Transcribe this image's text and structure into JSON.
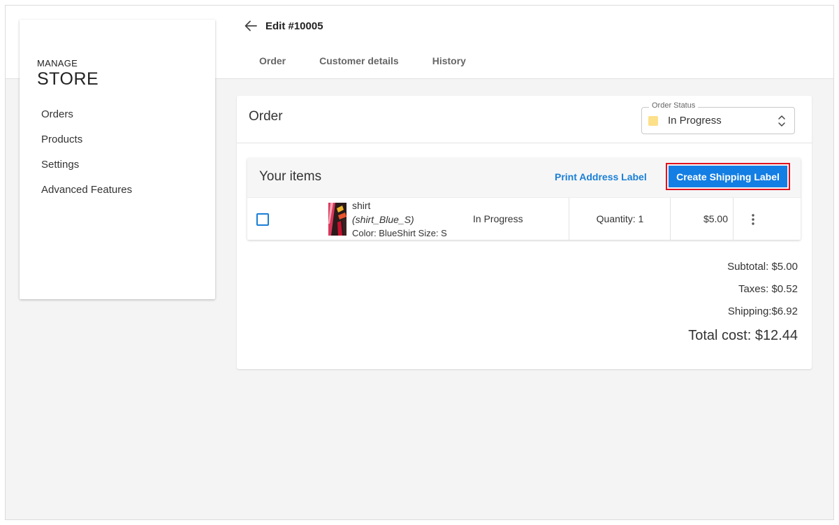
{
  "sidebar": {
    "brand_small": "MANAGE",
    "brand_big": "STORE",
    "items": [
      {
        "label": "Orders"
      },
      {
        "label": "Products"
      },
      {
        "label": "Settings"
      },
      {
        "label": "Advanced Features"
      }
    ]
  },
  "header": {
    "title": "Edit #10005",
    "back_icon": "arrow-left-icon",
    "tabs": [
      {
        "label": "Order"
      },
      {
        "label": "Customer details"
      },
      {
        "label": "History"
      }
    ]
  },
  "order": {
    "title": "Order",
    "status": {
      "legend": "Order Status",
      "value": "In Progress",
      "swatch_color": "#fce08a"
    },
    "items_panel": {
      "title": "Your items",
      "print_label": "Print Address Label",
      "ship_label": "Create Shipping Label",
      "ship_color": "#137ee3",
      "highlight_color": "#e0121d"
    },
    "item": {
      "name": "shirt",
      "sku": "(shirt_Blue_S)",
      "attributes": "Color: BlueShirt Size: S",
      "status": "In Progress",
      "quantity": "Quantity: 1",
      "price": "$5.00"
    },
    "totals": {
      "subtotal": "Subtotal: $5.00",
      "taxes": "Taxes: $0.52",
      "shipping": "Shipping:$6.92",
      "total": "Total cost: $12.44"
    }
  },
  "colors": {
    "link": "#1a7fd6",
    "background": "#f4f4f4"
  }
}
